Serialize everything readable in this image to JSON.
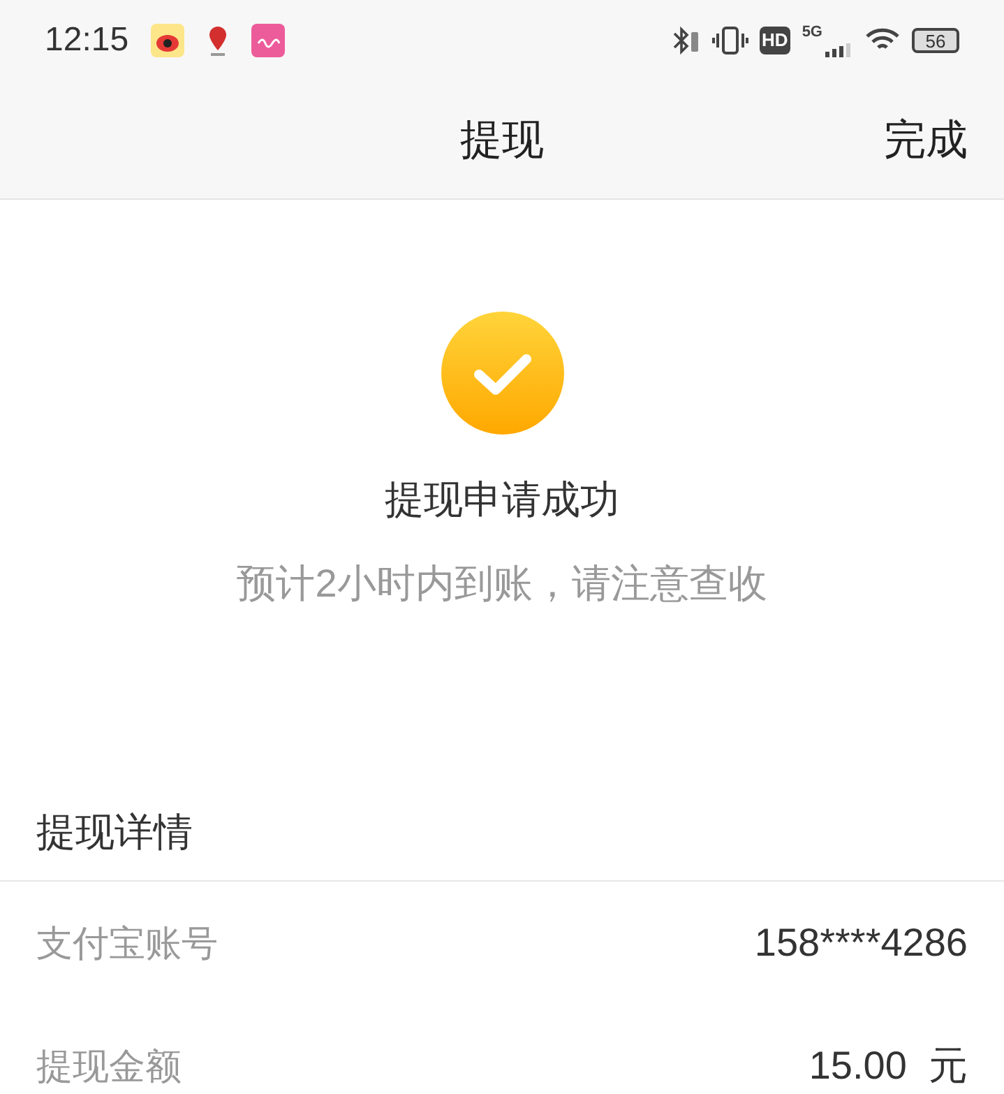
{
  "status_bar": {
    "time": "12:15",
    "network": "5G",
    "hd": "HD",
    "battery": "56"
  },
  "nav": {
    "title": "提现",
    "action": "完成"
  },
  "result": {
    "title": "提现申请成功",
    "subtitle": "预计2小时内到账，请注意查收"
  },
  "details": {
    "heading": "提现详情",
    "rows": [
      {
        "label": "支付宝账号",
        "value": "158****4286"
      },
      {
        "label": "提现金额",
        "value": "15.00  元"
      }
    ]
  }
}
